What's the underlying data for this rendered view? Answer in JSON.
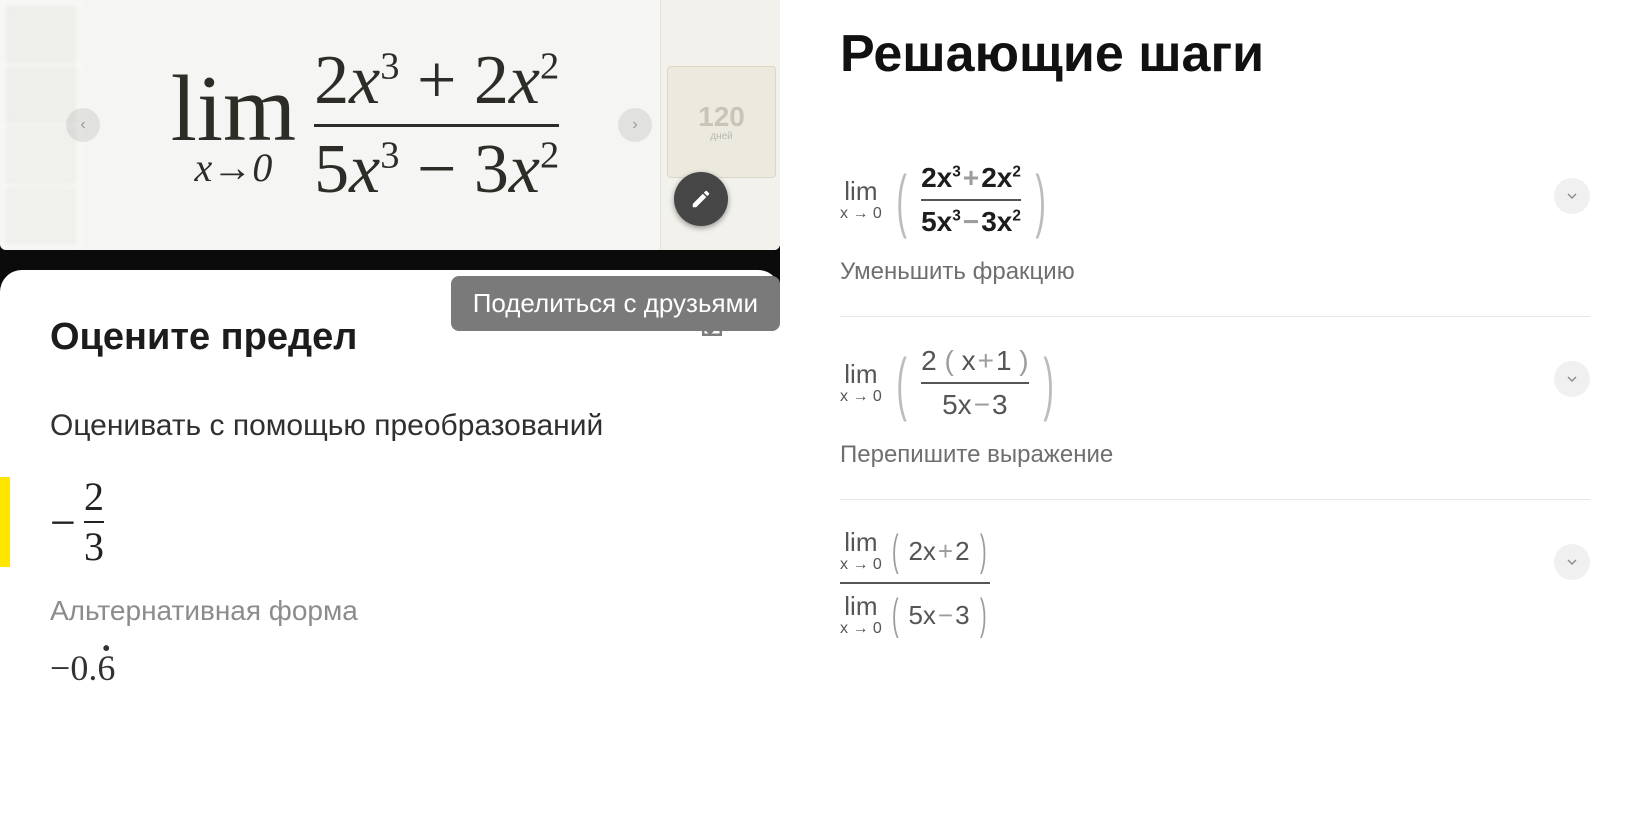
{
  "photo": {
    "lim_word": "lim",
    "lim_sub_html": "x→0",
    "numerator_html": "2x³ + 2x²",
    "denominator_html": "5x³ − 3x²",
    "ad_big": "120",
    "ad_small": "дней"
  },
  "tooltip": "Поделиться с друзьями",
  "card": {
    "title": "Оцените предел",
    "subtitle": "Оценивать с помощью преобразований",
    "result_sign": "−",
    "result_num": "2",
    "result_den": "3",
    "alt_label": "Альтернативная форма",
    "alt_sign": "−",
    "alt_int": "0.",
    "alt_dec": "6"
  },
  "right": {
    "title": "Решающие шаги",
    "steps": [
      {
        "lim_text": "lim",
        "lim_sub": "x → 0",
        "frac_top": "2x³ + 2x²",
        "frac_bot": "5x³ − 3x²",
        "bold": true,
        "big_paren": true,
        "caption": "Уменьшить фракцию"
      },
      {
        "lim_text": "lim",
        "lim_sub": "x → 0",
        "frac_top": "2 ( x + 1 )",
        "frac_bot": "5x − 3",
        "bold": false,
        "big_paren": true,
        "caption": "Перепишите выражение"
      },
      {
        "type": "limfrac",
        "lim_text": "lim",
        "lim_sub": "x → 0",
        "top_expr": "( 2x + 2 )",
        "bot_expr": "( 5x − 3 )"
      }
    ]
  },
  "chart_data": {
    "type": "table",
    "problem": "lim_{x→0} (2x^3 + 2x^2)/(5x^3 − 3x^2)",
    "answer": "-2/3",
    "answer_decimal": "-0.666…",
    "steps": [
      "lim_{x→0} (2x^3 + 2x^2)/(5x^3 − 3x^2)  — Уменьшить фракцию",
      "lim_{x→0} 2(x+1)/(5x − 3)  — Перепишите выражение",
      "lim_{x→0}(2x+2) / lim_{x→0}(5x − 3)"
    ]
  }
}
